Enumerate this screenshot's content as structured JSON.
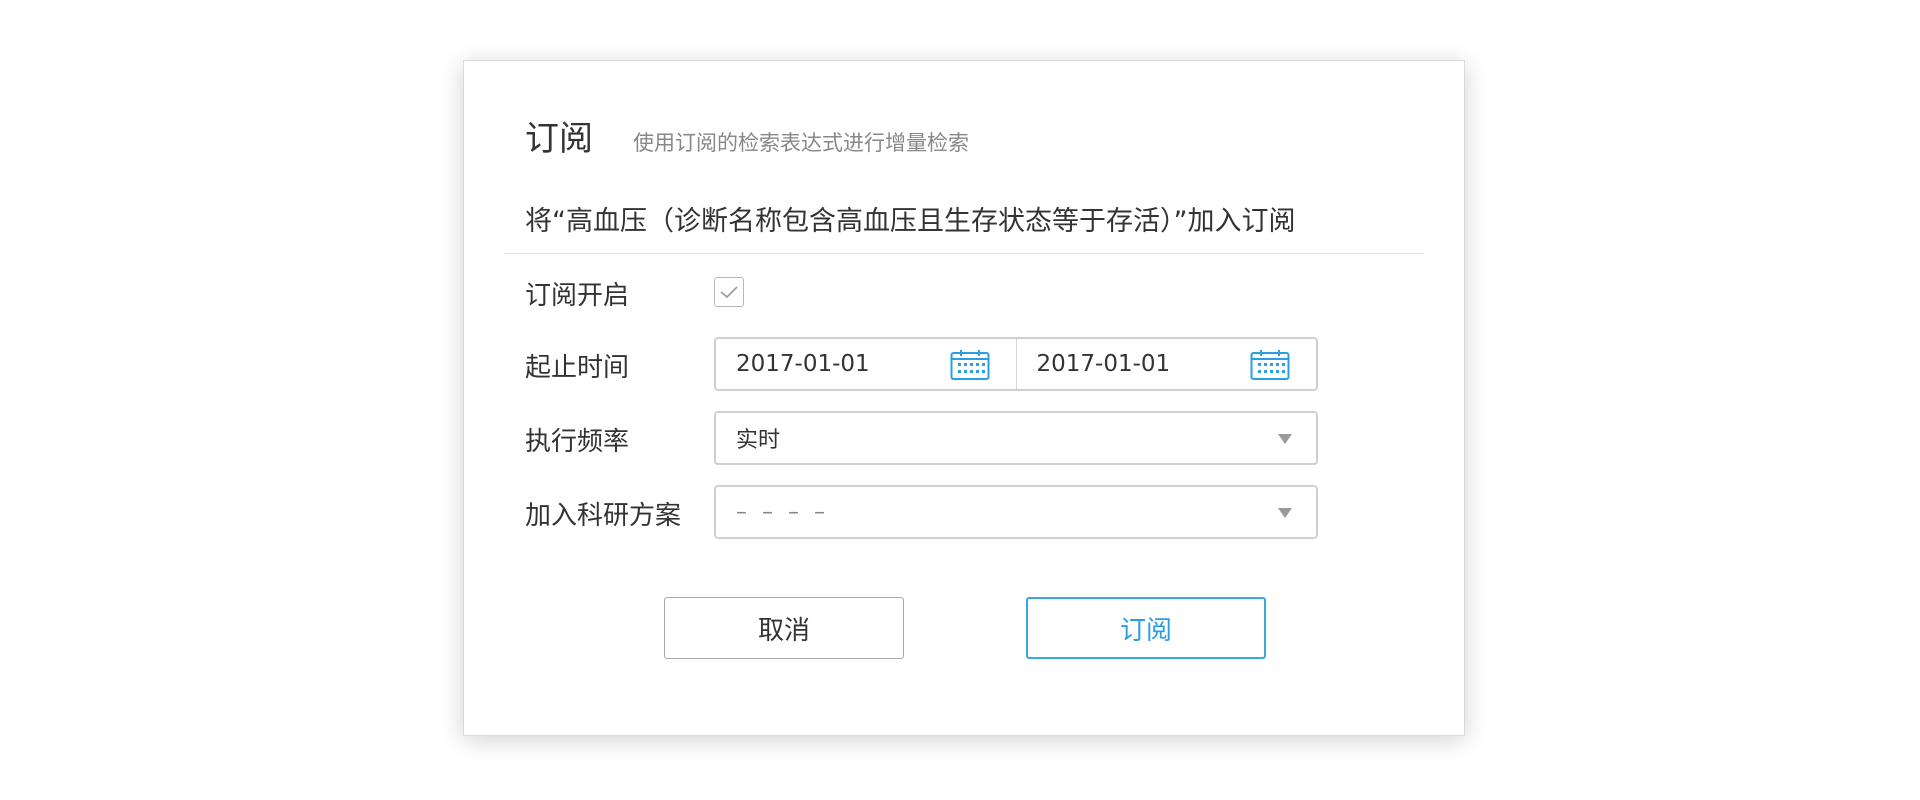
{
  "dialog": {
    "title": "订阅",
    "subtitle": "使用订阅的检索表达式进行增量检索",
    "notice": "将“高血压（诊断名称包含高血压且生存状态等于存活）”加入订阅"
  },
  "form": {
    "subscribe_enabled": {
      "label": "订阅开启",
      "checked": true
    },
    "date_range": {
      "label": "起止时间",
      "start": "2017-01-01",
      "end": "2017-01-01",
      "icon": "calendar-icon"
    },
    "frequency": {
      "label": "执行频率",
      "value": "实时"
    },
    "research_plan": {
      "label": "加入科研方案",
      "value": "– – – –"
    }
  },
  "buttons": {
    "cancel": "取消",
    "subscribe": "订阅"
  },
  "colors": {
    "accent": "#2a9ee0",
    "border": "#cfcfcf",
    "text": "#333333",
    "muted": "#888888"
  }
}
